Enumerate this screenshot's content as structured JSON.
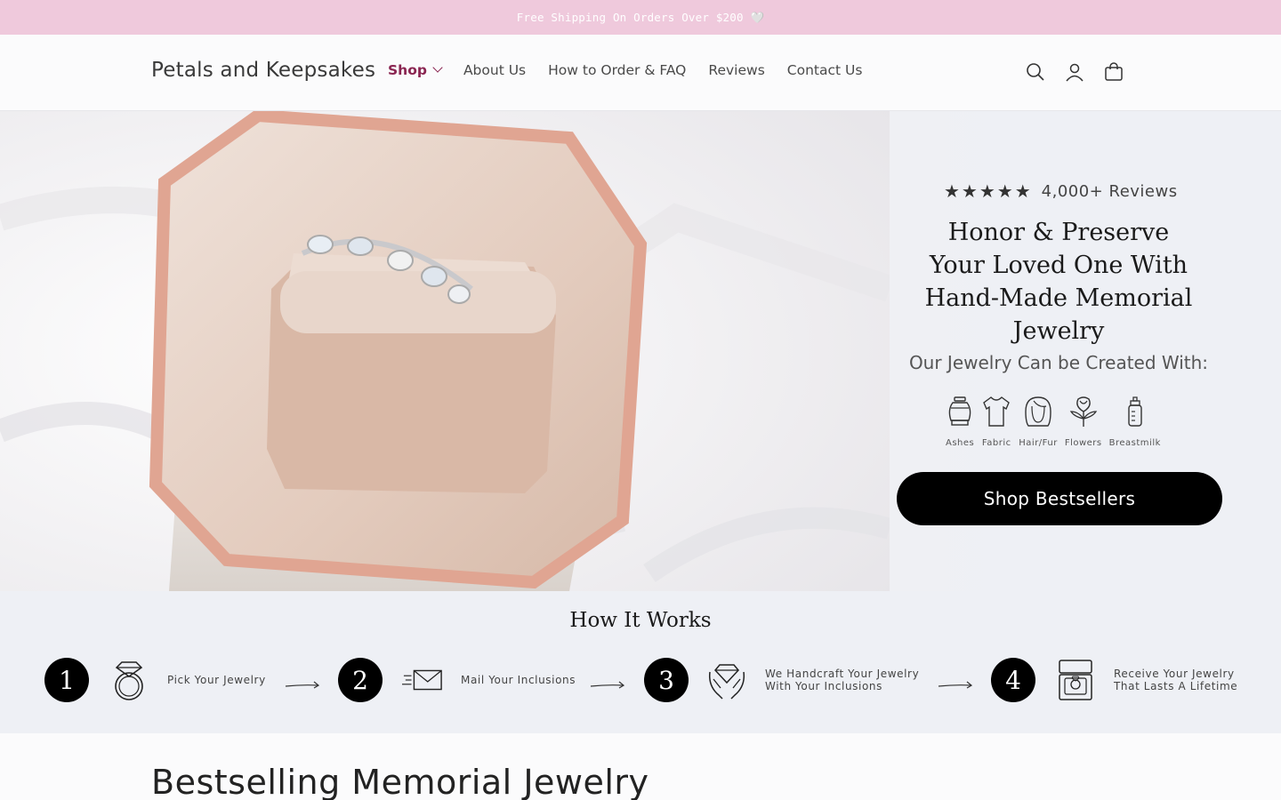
{
  "announcement": {
    "text": "Free Shipping On Orders Over $200 🤍"
  },
  "header": {
    "logo": "Petals and Keepsakes",
    "nav": [
      {
        "label": "Shop"
      },
      {
        "label": "About Us"
      },
      {
        "label": "How to Order & FAQ"
      },
      {
        "label": "Reviews"
      },
      {
        "label": "Contact Us"
      }
    ],
    "icons": [
      "search-icon",
      "account-icon",
      "cart-icon"
    ]
  },
  "hero": {
    "stars": "★★★★★",
    "rating": 5,
    "reviews": "4,000+ Reviews",
    "headline_lines": [
      "Honor & Preserve",
      "Your Loved One With",
      "Hand-Made Memorial Jewelry"
    ],
    "created_with": "Our Jewelry Can be Created With:",
    "inclusions": [
      {
        "label": "Ashes",
        "icon": "urn-icon"
      },
      {
        "label": "Fabric",
        "icon": "shirt-icon"
      },
      {
        "label": "Hair/Fur",
        "icon": "hair-icon"
      },
      {
        "label": "Flowers",
        "icon": "rose-icon"
      },
      {
        "label": "Breastmilk",
        "icon": "bottle-icon"
      }
    ],
    "cta": "Shop Bestsellers"
  },
  "how_it_works": {
    "title": "How It Works",
    "steps": [
      {
        "number": "1",
        "text_lines": [
          "Pick Your Jewelry"
        ],
        "icon": "ring-icon"
      },
      {
        "number": "2",
        "text_lines": [
          "Mail Your Inclusions"
        ],
        "icon": "envelope-icon"
      },
      {
        "number": "3",
        "text_lines": [
          "We Handcraft Your Jewelry",
          "With Your Inclusions"
        ],
        "icon": "hands-diamond-icon"
      },
      {
        "number": "4",
        "text_lines": [
          "Receive Your Jewelry",
          "That Lasts A Lifetime"
        ],
        "icon": "ring-box-icon"
      }
    ]
  },
  "bestselling": {
    "title": "Bestselling Memorial Jewelry"
  },
  "colors": {
    "announcement_bg": "#efc9dc",
    "accent": "#8a2551",
    "cta_bg": "#000000"
  }
}
